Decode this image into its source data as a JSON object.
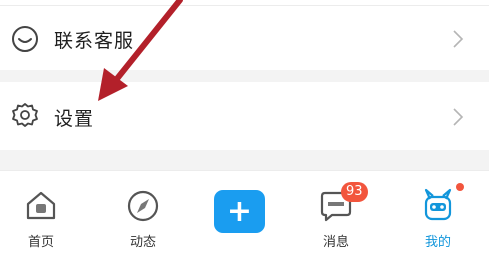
{
  "menu": {
    "customer_service": {
      "label": "联系客服",
      "icon": "headset-icon"
    },
    "settings": {
      "label": "设置",
      "icon": "gear-icon"
    }
  },
  "tabbar": {
    "home": {
      "label": "首页",
      "icon": "home-icon"
    },
    "feed": {
      "label": "动态",
      "icon": "compass-icon"
    },
    "add": {
      "label": "+",
      "icon": "plus-icon"
    },
    "messages": {
      "label": "消息",
      "icon": "message-icon",
      "badge": "93"
    },
    "me": {
      "label": "我的",
      "icon": "mascot-icon",
      "has_dot": true
    }
  },
  "colors": {
    "accent": "#1a9df0",
    "badge": "#f2553d",
    "annotation_arrow": "#b3202a"
  }
}
